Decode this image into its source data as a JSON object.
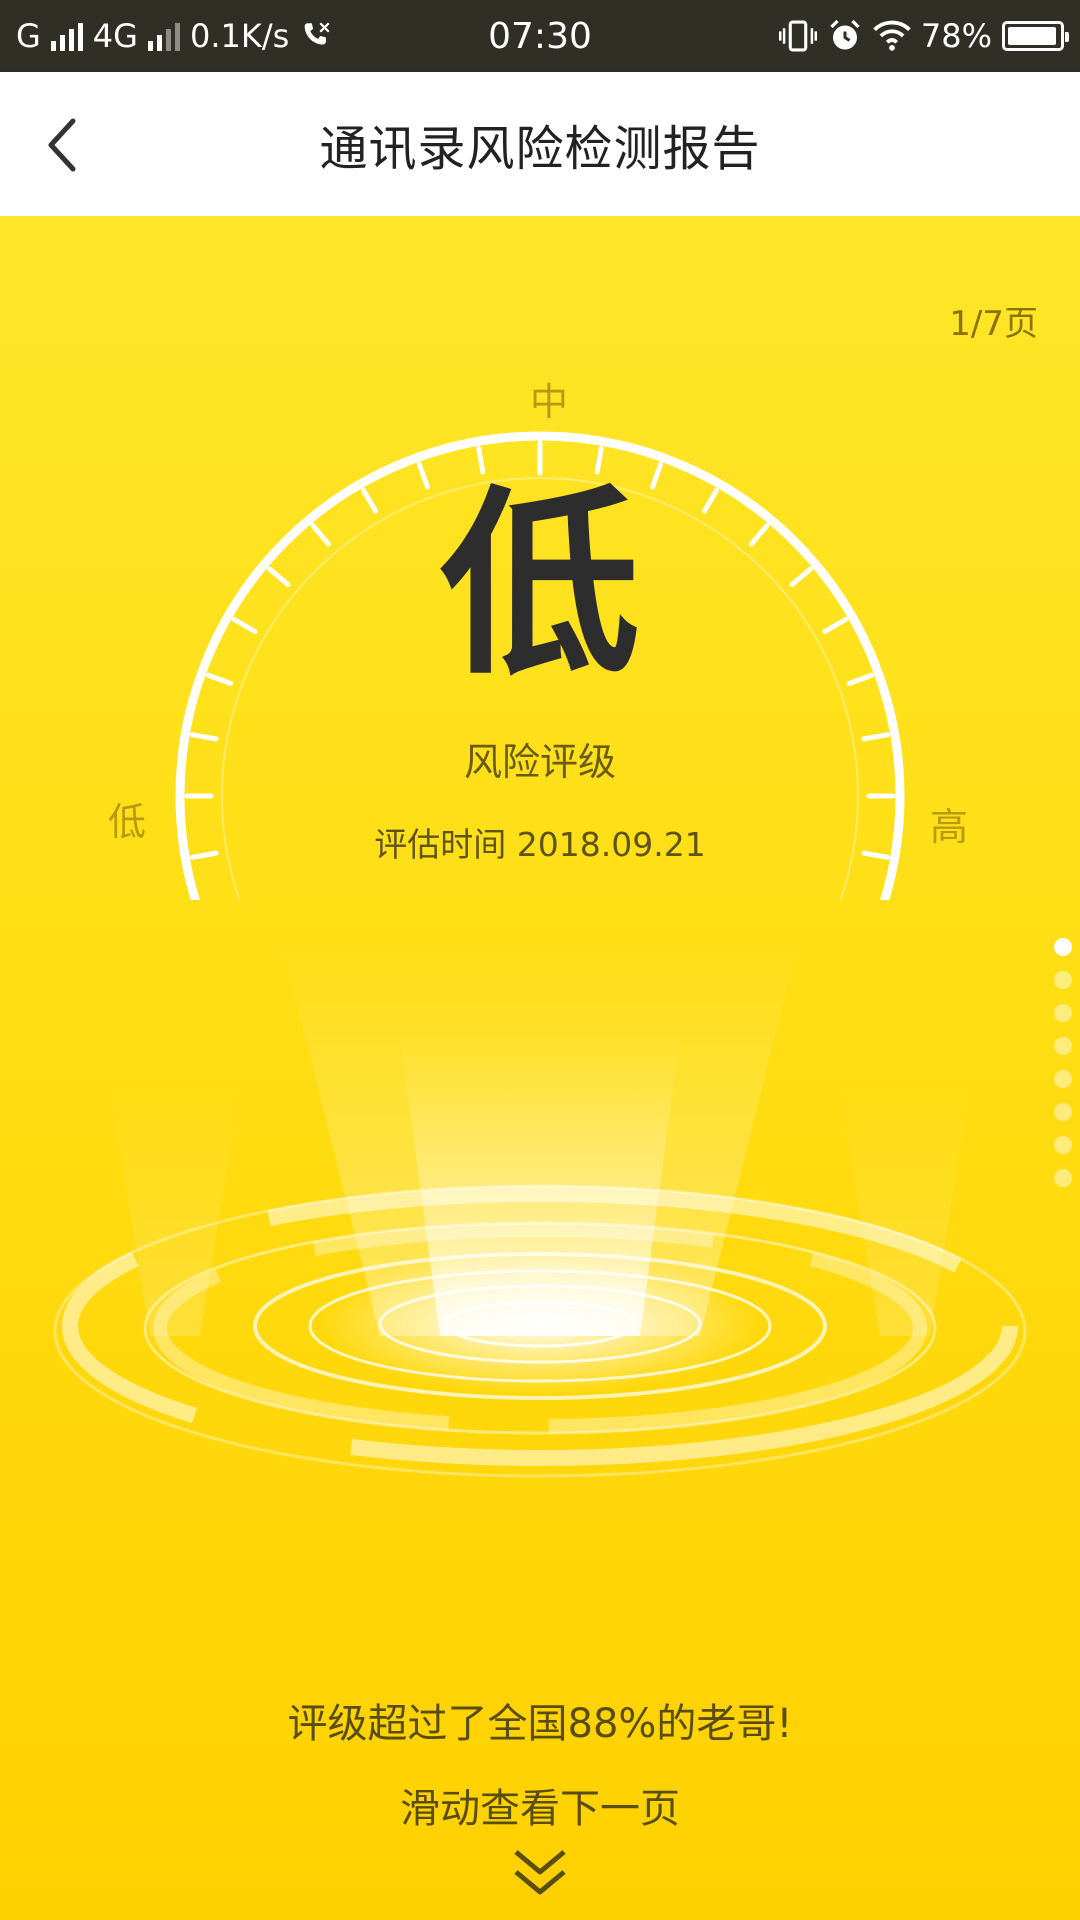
{
  "status_bar": {
    "carrier1": "G",
    "carrier2": "4G",
    "speed": "0.1K/s",
    "time": "07:30",
    "battery": "78%"
  },
  "header": {
    "title": "通讯录风险检测报告"
  },
  "report": {
    "page_indicator": "1/7页",
    "gauge_labels": {
      "low": "低",
      "mid": "中",
      "high": "高"
    },
    "risk_level": "低",
    "risk_caption": "风险评级",
    "assess_time": "评估时间 2018.09.21",
    "summary": "评级超过了全国88%的老哥!",
    "swipe_hint": "滑动查看下一页",
    "current_page": 1,
    "total_pages": 8
  },
  "colors": {
    "background_top": "#ffe629",
    "background_bottom": "#ffd000",
    "label_gold": "#b89a10",
    "text_dark": "#2d2d2d"
  },
  "icons": {
    "back": "chevron-left-icon",
    "swipe": "double-chevron-down-icon"
  }
}
